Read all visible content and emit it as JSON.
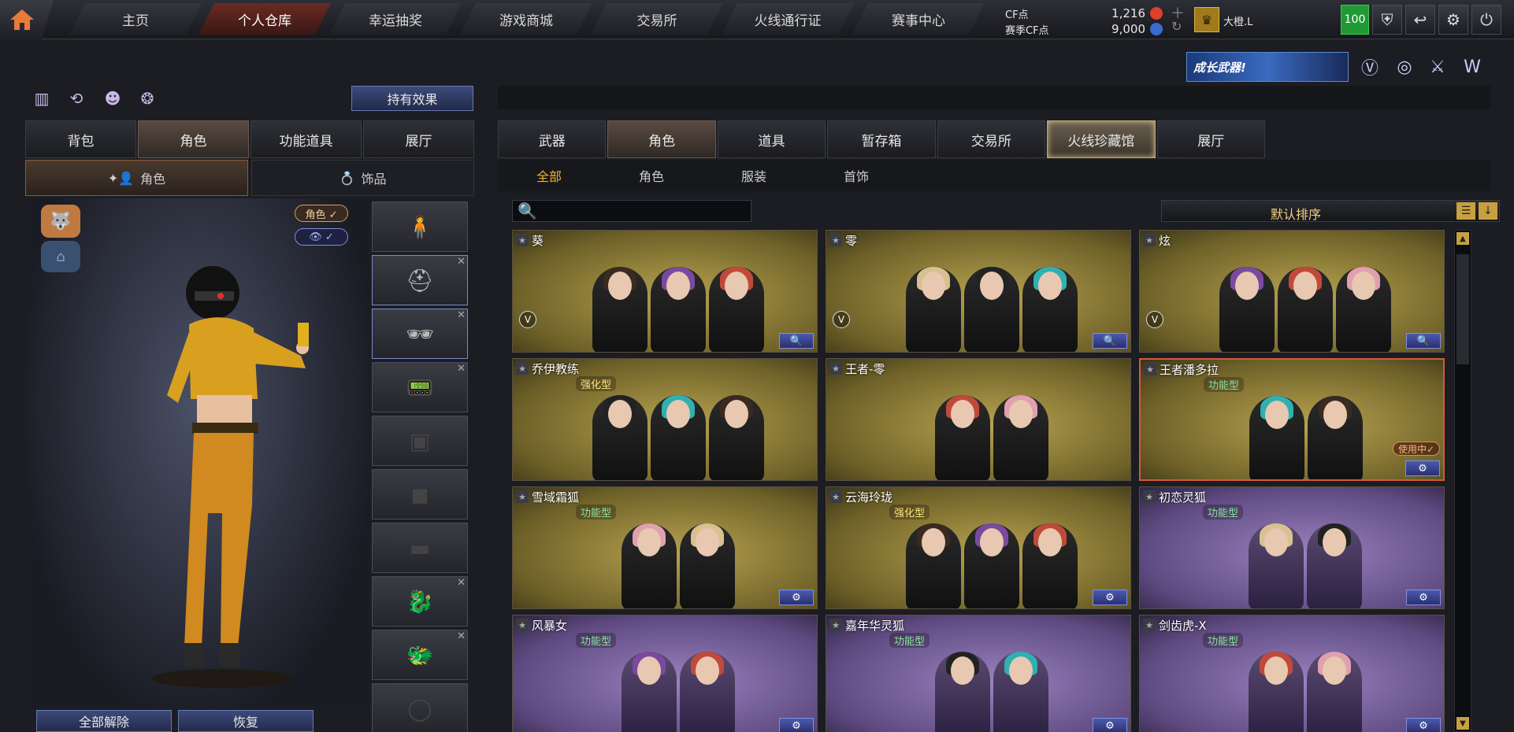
{
  "nav": {
    "tabs": [
      "主页",
      "个人仓库",
      "幸运抽奖",
      "游戏商城",
      "交易所",
      "火线通行证",
      "赛事中心"
    ],
    "active": 1
  },
  "currency": {
    "cf_label": "CF点",
    "cf_value": "1,216",
    "event_label": "赛季CF点",
    "event_value": "9,000",
    "cf_color": "#e0402a",
    "event_color": "#3a6ad0"
  },
  "user": {
    "name": "大橙.L",
    "level": "100"
  },
  "growth_banner": "成长武器!",
  "left": {
    "effect_button": "持有效果",
    "tabs": [
      "背包",
      "角色",
      "功能道具",
      "展厅"
    ],
    "active_tab": 1,
    "subtabs": [
      "角色",
      "饰品"
    ],
    "active_subtab": 0,
    "char_toggle": "角色 ✓",
    "view_toggle": "👁 ✓",
    "unequip_button": "全部解除",
    "restore_button": "恢复"
  },
  "right": {
    "tabs": [
      "武器",
      "角色",
      "道具",
      "暂存箱",
      "交易所",
      "火线珍藏馆",
      "展厅"
    ],
    "active_tab": 1,
    "special_tab": 5,
    "subtabs": [
      "全部",
      "角色",
      "服装",
      "首饰"
    ],
    "active_subtab": 0,
    "search_placeholder": "",
    "sort_label": "默认排序"
  },
  "cards": [
    {
      "name": "葵",
      "tag": "",
      "theme": "gold",
      "v": true,
      "action": "🔍"
    },
    {
      "name": "零",
      "tag": "",
      "theme": "gold",
      "v": true,
      "action": "🔍"
    },
    {
      "name": "炫",
      "tag": "",
      "theme": "gold",
      "v": true,
      "action": "🔍"
    },
    {
      "name": "乔伊教练",
      "tag": "强化型",
      "theme": "gold",
      "v": false,
      "action": ""
    },
    {
      "name": "王者-零",
      "tag": "",
      "theme": "gold",
      "v": false,
      "action": ""
    },
    {
      "name": "王者潘多拉",
      "tag": "功能型",
      "theme": "gold",
      "v": false,
      "action": "⚙",
      "inuse": "使用中✓"
    },
    {
      "name": "雪域霜狐",
      "tag": "功能型",
      "theme": "gold",
      "v": false,
      "action": "⚙"
    },
    {
      "name": "云海玲珑",
      "tag": "强化型",
      "theme": "gold",
      "v": false,
      "action": "⚙"
    },
    {
      "name": "初恋灵狐",
      "tag": "功能型",
      "theme": "purple",
      "v": false,
      "action": "⚙"
    },
    {
      "name": "风暴女",
      "tag": "功能型",
      "theme": "purple",
      "v": false,
      "action": "⚙"
    },
    {
      "name": "嘉年华灵狐",
      "tag": "功能型",
      "theme": "purple",
      "v": false,
      "action": "⚙"
    },
    {
      "name": "剑齿虎-X",
      "tag": "功能型",
      "theme": "purple",
      "v": false,
      "action": "⚙"
    }
  ]
}
